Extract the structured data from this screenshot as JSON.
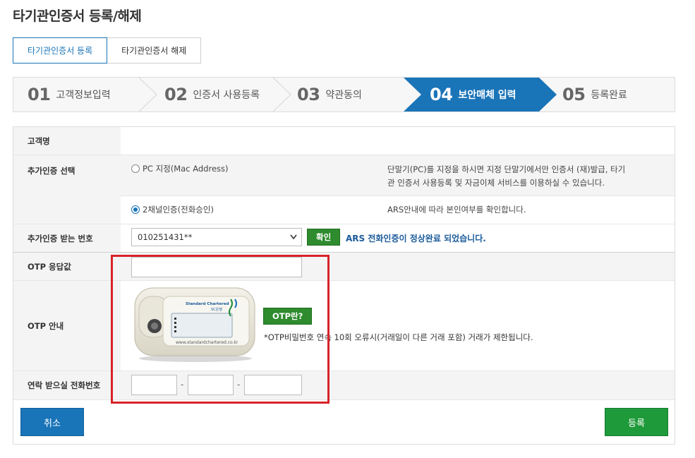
{
  "page": {
    "title": "타기관인증서 등록/해제"
  },
  "tabs": [
    {
      "label": "타기관인증서 등록",
      "active": true
    },
    {
      "label": "타기관인증서 해제",
      "active": false
    }
  ],
  "steps": [
    {
      "num": "01",
      "label": "고객정보입력"
    },
    {
      "num": "02",
      "label": "인증서 사용등록"
    },
    {
      "num": "03",
      "label": "약관동의"
    },
    {
      "num": "04",
      "label": "보안매체 입력",
      "active": true
    },
    {
      "num": "05",
      "label": "등록완료"
    }
  ],
  "form": {
    "customer_name_label": "고객명",
    "auth_select_label": "추가인증 선택",
    "option_pc": "PC 지정(Mac Address)",
    "option_pc_desc_1": "단말기(PC)를 지정을 하시면 지정 단말기에서만 인증서 (재)발급, 타기",
    "option_pc_desc_2": "관 인증서 사용등록 및 자금이체 서비스를 이용하실 수 있습니다.",
    "option_2ch": "2채널인증(전화승인)",
    "option_2ch_desc": "ARS안내에 따라 본인여부를 확인합니다.",
    "phone_label": "추가인증 받는 번호",
    "phone_value": "010251431**",
    "confirm_button": "확인",
    "ars_status": "ARS 전화인증이 정상완료 되었습니다.",
    "otp_response_label": "OTP 응답값",
    "otp_guide_label": "OTP 안내",
    "otp_device_brand": "Standard Chartered",
    "otp_device_brand_sub": "SC은행",
    "otp_device_url": "www.standardchartered.co.kr",
    "otp_what_button": "OTP란?",
    "otp_notice": "*OTP비밀번호 연속 10회 오류시(거래일이 다른 거래 포함) 거래가 제한됩니다.",
    "contact_phone_label": "연락 받으실 전화번호",
    "dash": "-"
  },
  "buttons": {
    "cancel": "취소",
    "register": "등록"
  },
  "colors": {
    "primary_blue": "#1a74b8",
    "green": "#1f9a3a",
    "highlight_red": "#d8232a"
  }
}
